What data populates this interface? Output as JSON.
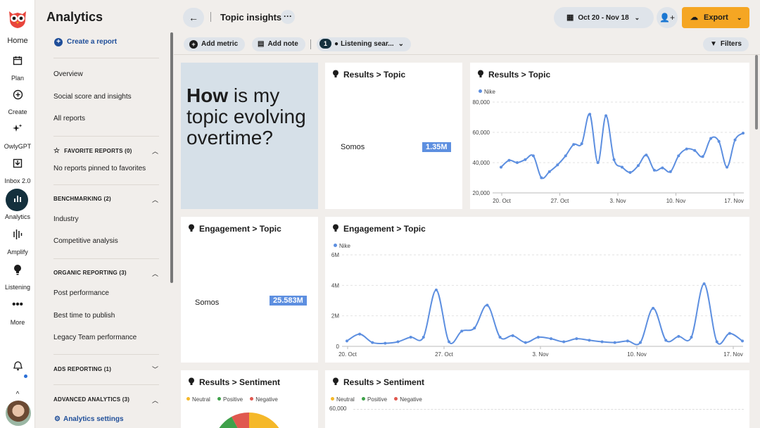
{
  "rail": {
    "items": [
      {
        "label": "Home",
        "icon": "owl-logo"
      },
      {
        "label": "Plan",
        "icon": "calendar-icon"
      },
      {
        "label": "Create",
        "icon": "plus-circle-icon"
      },
      {
        "label": "OwlyGPT",
        "icon": "sparkle-icon"
      },
      {
        "label": "Inbox 2.0",
        "icon": "inbox-icon"
      },
      {
        "label": "Analytics",
        "icon": "analytics-icon"
      },
      {
        "label": "Amplify",
        "icon": "amplify-icon"
      },
      {
        "label": "Listening",
        "icon": "lightbulb-icon"
      },
      {
        "label": "More",
        "icon": "more-icon"
      }
    ],
    "active": "Analytics"
  },
  "nav": {
    "title": "Analytics",
    "create_report": "Create a report",
    "links_top": [
      "Overview",
      "Social score and insights",
      "All reports"
    ],
    "favorites": {
      "title": "FAVORITE REPORTS (0)",
      "empty": "No reports pinned to favorites"
    },
    "benchmarking": {
      "title": "BENCHMARKING (2)",
      "items": [
        "Industry",
        "Competitive analysis"
      ]
    },
    "organic": {
      "title": "ORGANIC REPORTING (3)",
      "items": [
        "Post performance",
        "Best time to publish",
        "Legacy Team performance"
      ]
    },
    "ads": {
      "title": "ADS REPORTING (1)"
    },
    "advanced": {
      "title": "ADVANCED ANALYTICS (3)"
    },
    "settings": "Analytics settings"
  },
  "topbar": {
    "title": "Topic insights",
    "date_range": "Oct 20 - Nov 18",
    "export_label": "Export"
  },
  "filterbar": {
    "add_metric": "Add metric",
    "add_note": "Add note",
    "listening_count": "1",
    "listening_label": "Listening sear...",
    "filters": "Filters"
  },
  "hero": {
    "bold": "How",
    "rest": " is my topic evolving overtime?"
  },
  "cards": {
    "results_topic_metric": {
      "title": "Results > Topic",
      "label": "Somos",
      "value": "1.35M"
    },
    "results_topic_chart": {
      "title": "Results > Topic",
      "legend": "Nike"
    },
    "engagement_topic_metric": {
      "title": "Engagement > Topic",
      "label": "Somos",
      "value": "25.583M"
    },
    "engagement_topic_chart": {
      "title": "Engagement > Topic",
      "legend": "Nike"
    },
    "results_sentiment_pie": {
      "title": "Results > Sentiment",
      "legend": [
        "Neutral",
        "Positive",
        "Negative"
      ]
    },
    "results_sentiment_chart": {
      "title": "Results > Sentiment",
      "legend": [
        "Neutral",
        "Positive",
        "Negative"
      ],
      "top_tick": "60,000"
    }
  },
  "colors": {
    "series": "#5d8fe0",
    "neutral": "#f5b829",
    "positive": "#3fa14a",
    "negative": "#e0584f",
    "accent": "#f5a623",
    "link": "#1f4e99"
  },
  "chart_data": [
    {
      "type": "line",
      "title": "Results > Topic",
      "x_ticks": [
        "20. Oct",
        "27. Oct",
        "3. Nov",
        "10. Nov",
        "17. Nov"
      ],
      "y_ticks": [
        "20,000",
        "40,000",
        "60,000",
        "80,000"
      ],
      "ylim": [
        20000,
        80000
      ],
      "series": [
        {
          "name": "Nike",
          "values": [
            37000,
            41500,
            40000,
            42000,
            44500,
            30000,
            34000,
            38500,
            44500,
            52000,
            52500,
            72000,
            40000,
            71000,
            42000,
            37000,
            33500,
            38000,
            45000,
            35000,
            36500,
            34000,
            44500,
            49000,
            48000,
            44000,
            56000,
            54000,
            37000,
            55000,
            59500
          ]
        }
      ]
    },
    {
      "type": "line",
      "title": "Engagement > Topic",
      "x_ticks": [
        "20. Oct",
        "27. Oct",
        "3. Nov",
        "10. Nov",
        "17. Nov"
      ],
      "y_ticks": [
        "0",
        "2M",
        "4M",
        "6M"
      ],
      "ylim": [
        0,
        6000000
      ],
      "series": [
        {
          "name": "Nike",
          "values": [
            350000,
            800000,
            250000,
            200000,
            300000,
            600000,
            600000,
            3700000,
            300000,
            1000000,
            1200000,
            2700000,
            600000,
            700000,
            250000,
            600000,
            500000,
            300000,
            500000,
            400000,
            300000,
            250000,
            350000,
            250000,
            2500000,
            400000,
            650000,
            600000,
            4100000,
            300000,
            850000,
            350000
          ]
        }
      ]
    }
  ]
}
